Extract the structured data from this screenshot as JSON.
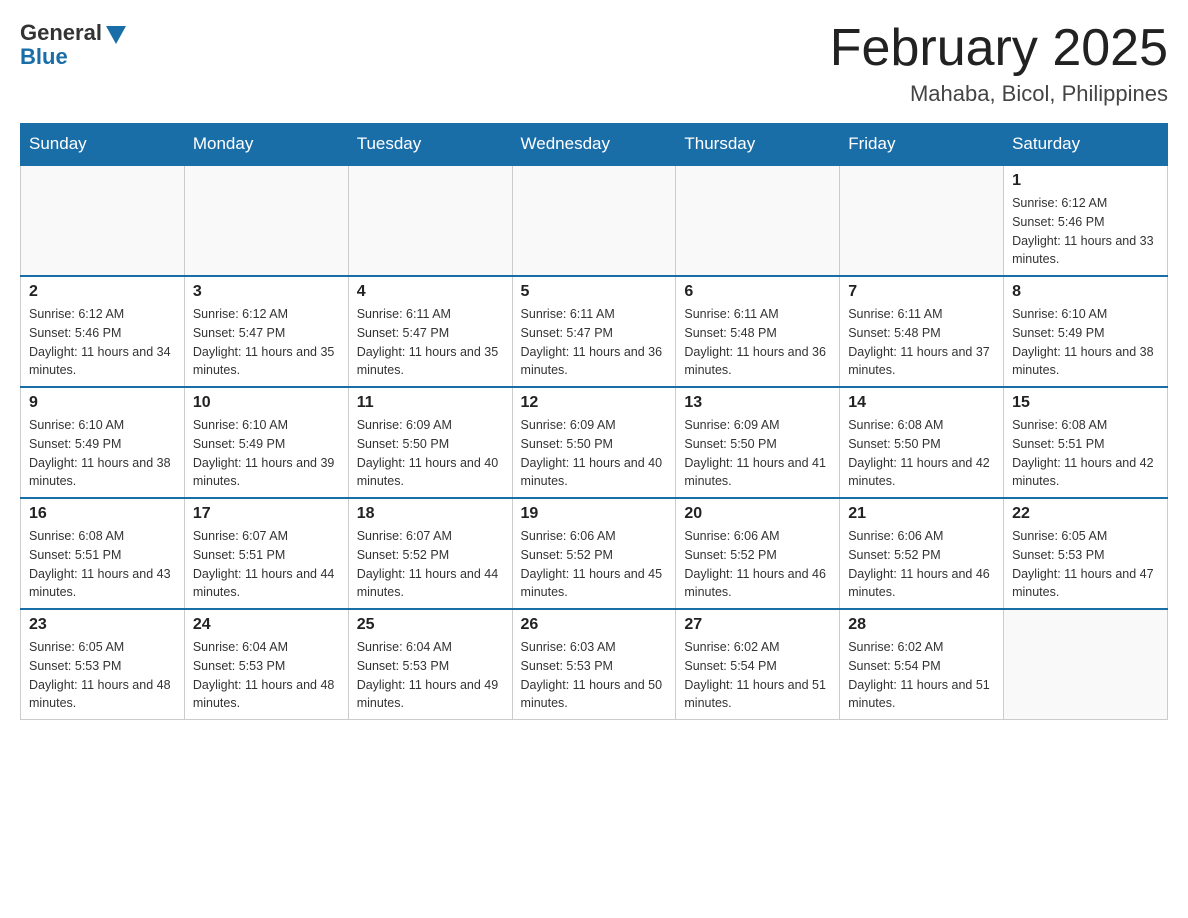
{
  "logo": {
    "general": "General",
    "blue": "Blue"
  },
  "header": {
    "month_year": "February 2025",
    "location": "Mahaba, Bicol, Philippines"
  },
  "weekdays": [
    "Sunday",
    "Monday",
    "Tuesday",
    "Wednesday",
    "Thursday",
    "Friday",
    "Saturday"
  ],
  "weeks": [
    [
      {
        "day": "",
        "sunrise": "",
        "sunset": "",
        "daylight": ""
      },
      {
        "day": "",
        "sunrise": "",
        "sunset": "",
        "daylight": ""
      },
      {
        "day": "",
        "sunrise": "",
        "sunset": "",
        "daylight": ""
      },
      {
        "day": "",
        "sunrise": "",
        "sunset": "",
        "daylight": ""
      },
      {
        "day": "",
        "sunrise": "",
        "sunset": "",
        "daylight": ""
      },
      {
        "day": "",
        "sunrise": "",
        "sunset": "",
        "daylight": ""
      },
      {
        "day": "1",
        "sunrise": "Sunrise: 6:12 AM",
        "sunset": "Sunset: 5:46 PM",
        "daylight": "Daylight: 11 hours and 33 minutes."
      }
    ],
    [
      {
        "day": "2",
        "sunrise": "Sunrise: 6:12 AM",
        "sunset": "Sunset: 5:46 PM",
        "daylight": "Daylight: 11 hours and 34 minutes."
      },
      {
        "day": "3",
        "sunrise": "Sunrise: 6:12 AM",
        "sunset": "Sunset: 5:47 PM",
        "daylight": "Daylight: 11 hours and 35 minutes."
      },
      {
        "day": "4",
        "sunrise": "Sunrise: 6:11 AM",
        "sunset": "Sunset: 5:47 PM",
        "daylight": "Daylight: 11 hours and 35 minutes."
      },
      {
        "day": "5",
        "sunrise": "Sunrise: 6:11 AM",
        "sunset": "Sunset: 5:47 PM",
        "daylight": "Daylight: 11 hours and 36 minutes."
      },
      {
        "day": "6",
        "sunrise": "Sunrise: 6:11 AM",
        "sunset": "Sunset: 5:48 PM",
        "daylight": "Daylight: 11 hours and 36 minutes."
      },
      {
        "day": "7",
        "sunrise": "Sunrise: 6:11 AM",
        "sunset": "Sunset: 5:48 PM",
        "daylight": "Daylight: 11 hours and 37 minutes."
      },
      {
        "day": "8",
        "sunrise": "Sunrise: 6:10 AM",
        "sunset": "Sunset: 5:49 PM",
        "daylight": "Daylight: 11 hours and 38 minutes."
      }
    ],
    [
      {
        "day": "9",
        "sunrise": "Sunrise: 6:10 AM",
        "sunset": "Sunset: 5:49 PM",
        "daylight": "Daylight: 11 hours and 38 minutes."
      },
      {
        "day": "10",
        "sunrise": "Sunrise: 6:10 AM",
        "sunset": "Sunset: 5:49 PM",
        "daylight": "Daylight: 11 hours and 39 minutes."
      },
      {
        "day": "11",
        "sunrise": "Sunrise: 6:09 AM",
        "sunset": "Sunset: 5:50 PM",
        "daylight": "Daylight: 11 hours and 40 minutes."
      },
      {
        "day": "12",
        "sunrise": "Sunrise: 6:09 AM",
        "sunset": "Sunset: 5:50 PM",
        "daylight": "Daylight: 11 hours and 40 minutes."
      },
      {
        "day": "13",
        "sunrise": "Sunrise: 6:09 AM",
        "sunset": "Sunset: 5:50 PM",
        "daylight": "Daylight: 11 hours and 41 minutes."
      },
      {
        "day": "14",
        "sunrise": "Sunrise: 6:08 AM",
        "sunset": "Sunset: 5:50 PM",
        "daylight": "Daylight: 11 hours and 42 minutes."
      },
      {
        "day": "15",
        "sunrise": "Sunrise: 6:08 AM",
        "sunset": "Sunset: 5:51 PM",
        "daylight": "Daylight: 11 hours and 42 minutes."
      }
    ],
    [
      {
        "day": "16",
        "sunrise": "Sunrise: 6:08 AM",
        "sunset": "Sunset: 5:51 PM",
        "daylight": "Daylight: 11 hours and 43 minutes."
      },
      {
        "day": "17",
        "sunrise": "Sunrise: 6:07 AM",
        "sunset": "Sunset: 5:51 PM",
        "daylight": "Daylight: 11 hours and 44 minutes."
      },
      {
        "day": "18",
        "sunrise": "Sunrise: 6:07 AM",
        "sunset": "Sunset: 5:52 PM",
        "daylight": "Daylight: 11 hours and 44 minutes."
      },
      {
        "day": "19",
        "sunrise": "Sunrise: 6:06 AM",
        "sunset": "Sunset: 5:52 PM",
        "daylight": "Daylight: 11 hours and 45 minutes."
      },
      {
        "day": "20",
        "sunrise": "Sunrise: 6:06 AM",
        "sunset": "Sunset: 5:52 PM",
        "daylight": "Daylight: 11 hours and 46 minutes."
      },
      {
        "day": "21",
        "sunrise": "Sunrise: 6:06 AM",
        "sunset": "Sunset: 5:52 PM",
        "daylight": "Daylight: 11 hours and 46 minutes."
      },
      {
        "day": "22",
        "sunrise": "Sunrise: 6:05 AM",
        "sunset": "Sunset: 5:53 PM",
        "daylight": "Daylight: 11 hours and 47 minutes."
      }
    ],
    [
      {
        "day": "23",
        "sunrise": "Sunrise: 6:05 AM",
        "sunset": "Sunset: 5:53 PM",
        "daylight": "Daylight: 11 hours and 48 minutes."
      },
      {
        "day": "24",
        "sunrise": "Sunrise: 6:04 AM",
        "sunset": "Sunset: 5:53 PM",
        "daylight": "Daylight: 11 hours and 48 minutes."
      },
      {
        "day": "25",
        "sunrise": "Sunrise: 6:04 AM",
        "sunset": "Sunset: 5:53 PM",
        "daylight": "Daylight: 11 hours and 49 minutes."
      },
      {
        "day": "26",
        "sunrise": "Sunrise: 6:03 AM",
        "sunset": "Sunset: 5:53 PM",
        "daylight": "Daylight: 11 hours and 50 minutes."
      },
      {
        "day": "27",
        "sunrise": "Sunrise: 6:02 AM",
        "sunset": "Sunset: 5:54 PM",
        "daylight": "Daylight: 11 hours and 51 minutes."
      },
      {
        "day": "28",
        "sunrise": "Sunrise: 6:02 AM",
        "sunset": "Sunset: 5:54 PM",
        "daylight": "Daylight: 11 hours and 51 minutes."
      },
      {
        "day": "",
        "sunrise": "",
        "sunset": "",
        "daylight": ""
      }
    ]
  ]
}
